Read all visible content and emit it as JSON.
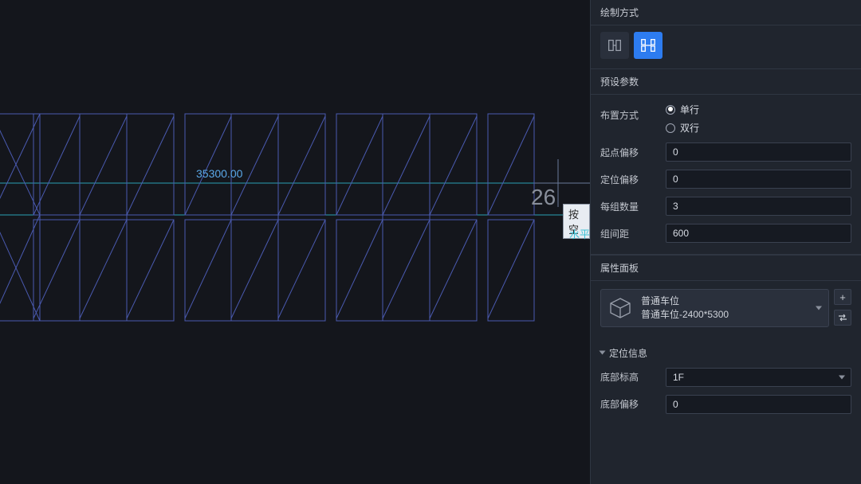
{
  "canvas": {
    "dimension_text": "35300.00",
    "big_number": "26",
    "tip_text": "按空",
    "horizontal_label": "水平"
  },
  "panel": {
    "draw_mode": {
      "title": "绘制方式"
    },
    "preset": {
      "title": "预设参数",
      "layout_label": "布置方式",
      "radio_single": "单行",
      "radio_double": "双行",
      "start_offset_label": "起点偏移",
      "start_offset_value": "0",
      "pos_offset_label": "定位偏移",
      "pos_offset_value": "0",
      "group_count_label": "每组数量",
      "group_count_value": "3",
      "group_gap_label": "组间距",
      "group_gap_value": "600"
    },
    "props": {
      "title": "属性面板",
      "component_name": "普通车位",
      "component_detail": "普通车位-2400*5300",
      "pos_section": "定位信息",
      "bottom_level_label": "底部标高",
      "bottom_level_value": "1F",
      "bottom_offset_label": "底部偏移",
      "bottom_offset_value": "0"
    }
  }
}
